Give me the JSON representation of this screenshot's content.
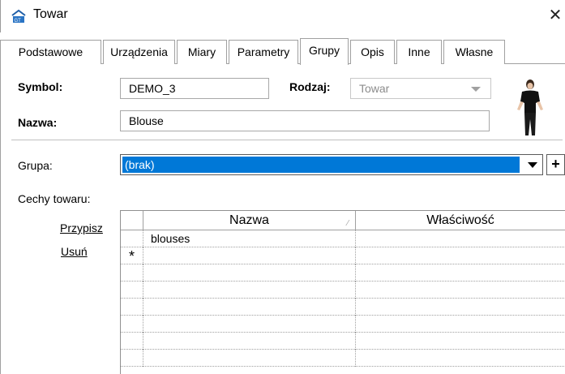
{
  "window": {
    "title": "Towar",
    "close_glyph": "✕"
  },
  "tabs": [
    {
      "label": "Podstawowe",
      "active": false
    },
    {
      "label": "Urządzenia",
      "active": false
    },
    {
      "label": "Miary",
      "active": false
    },
    {
      "label": "Parametry",
      "active": false
    },
    {
      "label": "Grupy",
      "active": true
    },
    {
      "label": "Opis",
      "active": false
    },
    {
      "label": "Inne",
      "active": false
    },
    {
      "label": "Własne",
      "active": false
    }
  ],
  "form": {
    "symbol_label": "Symbol:",
    "symbol_value": "DEMO_3",
    "rodzaj_label": "Rodzaj:",
    "rodzaj_value": "Towar",
    "nazwa_label": "Nazwa:",
    "nazwa_value": "Blouse",
    "grupa_label": "Grupa:",
    "grupa_value": "(brak)",
    "plus_label": "+",
    "cechy_label": "Cechy towaru:"
  },
  "actions": {
    "przypisz": "Przypisz",
    "usun": "Usuń"
  },
  "grid": {
    "columns": [
      "Nazwa",
      "Właściwość"
    ],
    "rows": [
      {
        "marker": "",
        "nazwa": "blouses",
        "wlasciwosc": ""
      },
      {
        "marker": "*",
        "nazwa": "",
        "wlasciwosc": ""
      }
    ]
  },
  "colors": {
    "selection": "#0078d7",
    "border": "#a0a0a0"
  },
  "icons": {
    "app": "app-logo-icon",
    "product": "product-photo"
  }
}
